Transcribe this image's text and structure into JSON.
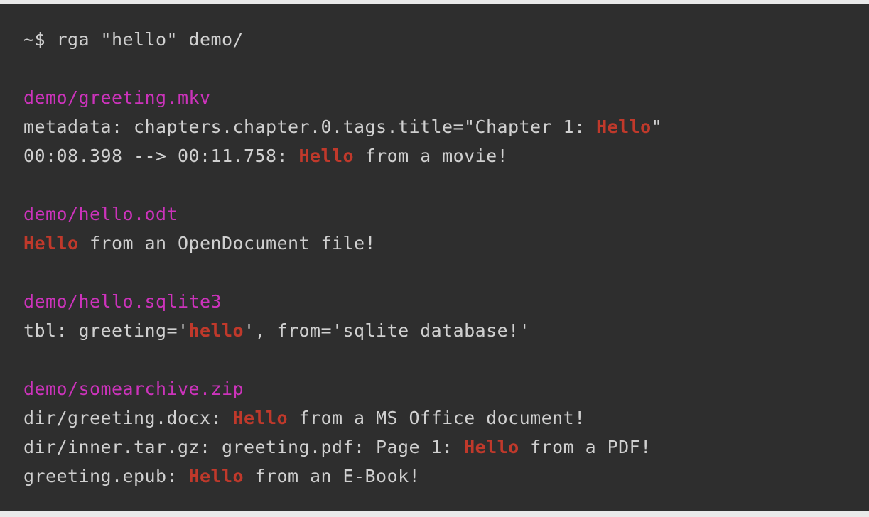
{
  "terminal": {
    "background_color": "#2e2e2e",
    "foreground_color": "#d0d0d0",
    "path_color": "#cc33bb",
    "match_color": "#c0392b",
    "page_background_color": "#e9e9e9",
    "prompt": "~$ ",
    "command": "rga \"hello\" demo/",
    "search_term": "hello",
    "search_path": "demo/"
  },
  "lines": [
    {
      "id": "command-line",
      "kind": "command",
      "segments": [
        {
          "text": "~$ ",
          "style": "prompt"
        },
        {
          "text": "rga \"hello\" demo/",
          "style": "plain"
        }
      ]
    },
    {
      "id": "blank-1",
      "kind": "blank",
      "segments": []
    },
    {
      "id": "file-header-mkv",
      "kind": "file-header",
      "segments": [
        {
          "text": "demo/greeting.mkv",
          "style": "path"
        }
      ]
    },
    {
      "id": "result-mkv-metadata",
      "kind": "result",
      "segments": [
        {
          "text": "metadata: chapters.chapter.0.tags.title=\"Chapter 1: ",
          "style": "plain"
        },
        {
          "text": "Hello",
          "style": "match"
        },
        {
          "text": "\"",
          "style": "plain"
        }
      ]
    },
    {
      "id": "result-mkv-subtitle",
      "kind": "result",
      "segments": [
        {
          "text": "00:08.398 --> 00:11.758: ",
          "style": "plain"
        },
        {
          "text": "Hello",
          "style": "match"
        },
        {
          "text": " from a movie!",
          "style": "plain"
        }
      ]
    },
    {
      "id": "blank-2",
      "kind": "blank",
      "segments": []
    },
    {
      "id": "file-header-odt",
      "kind": "file-header",
      "segments": [
        {
          "text": "demo/hello.odt",
          "style": "path"
        }
      ]
    },
    {
      "id": "result-odt",
      "kind": "result",
      "segments": [
        {
          "text": "Hello",
          "style": "match"
        },
        {
          "text": " from an OpenDocument file!",
          "style": "plain"
        }
      ]
    },
    {
      "id": "blank-3",
      "kind": "blank",
      "segments": []
    },
    {
      "id": "file-header-sqlite",
      "kind": "file-header",
      "segments": [
        {
          "text": "demo/hello.sqlite3",
          "style": "path"
        }
      ]
    },
    {
      "id": "result-sqlite",
      "kind": "result",
      "segments": [
        {
          "text": "tbl: greeting='",
          "style": "plain"
        },
        {
          "text": "hello",
          "style": "match"
        },
        {
          "text": "', from='sqlite database!'",
          "style": "plain"
        }
      ]
    },
    {
      "id": "blank-4",
      "kind": "blank",
      "segments": []
    },
    {
      "id": "file-header-zip",
      "kind": "file-header",
      "segments": [
        {
          "text": "demo/somearchive.zip",
          "style": "path"
        }
      ]
    },
    {
      "id": "result-zip-docx",
      "kind": "result",
      "segments": [
        {
          "text": "dir/greeting.docx: ",
          "style": "plain"
        },
        {
          "text": "Hello",
          "style": "match"
        },
        {
          "text": " from a MS Office document!",
          "style": "plain"
        }
      ]
    },
    {
      "id": "result-zip-pdf",
      "kind": "result",
      "segments": [
        {
          "text": "dir/inner.tar.gz: greeting.pdf: Page 1: ",
          "style": "plain"
        },
        {
          "text": "Hello",
          "style": "match"
        },
        {
          "text": " from a PDF!",
          "style": "plain"
        }
      ]
    },
    {
      "id": "result-zip-epub",
      "kind": "result",
      "segments": [
        {
          "text": "greeting.epub: ",
          "style": "plain"
        },
        {
          "text": "Hello",
          "style": "match"
        },
        {
          "text": " from an E-Book!",
          "style": "plain"
        }
      ]
    }
  ]
}
